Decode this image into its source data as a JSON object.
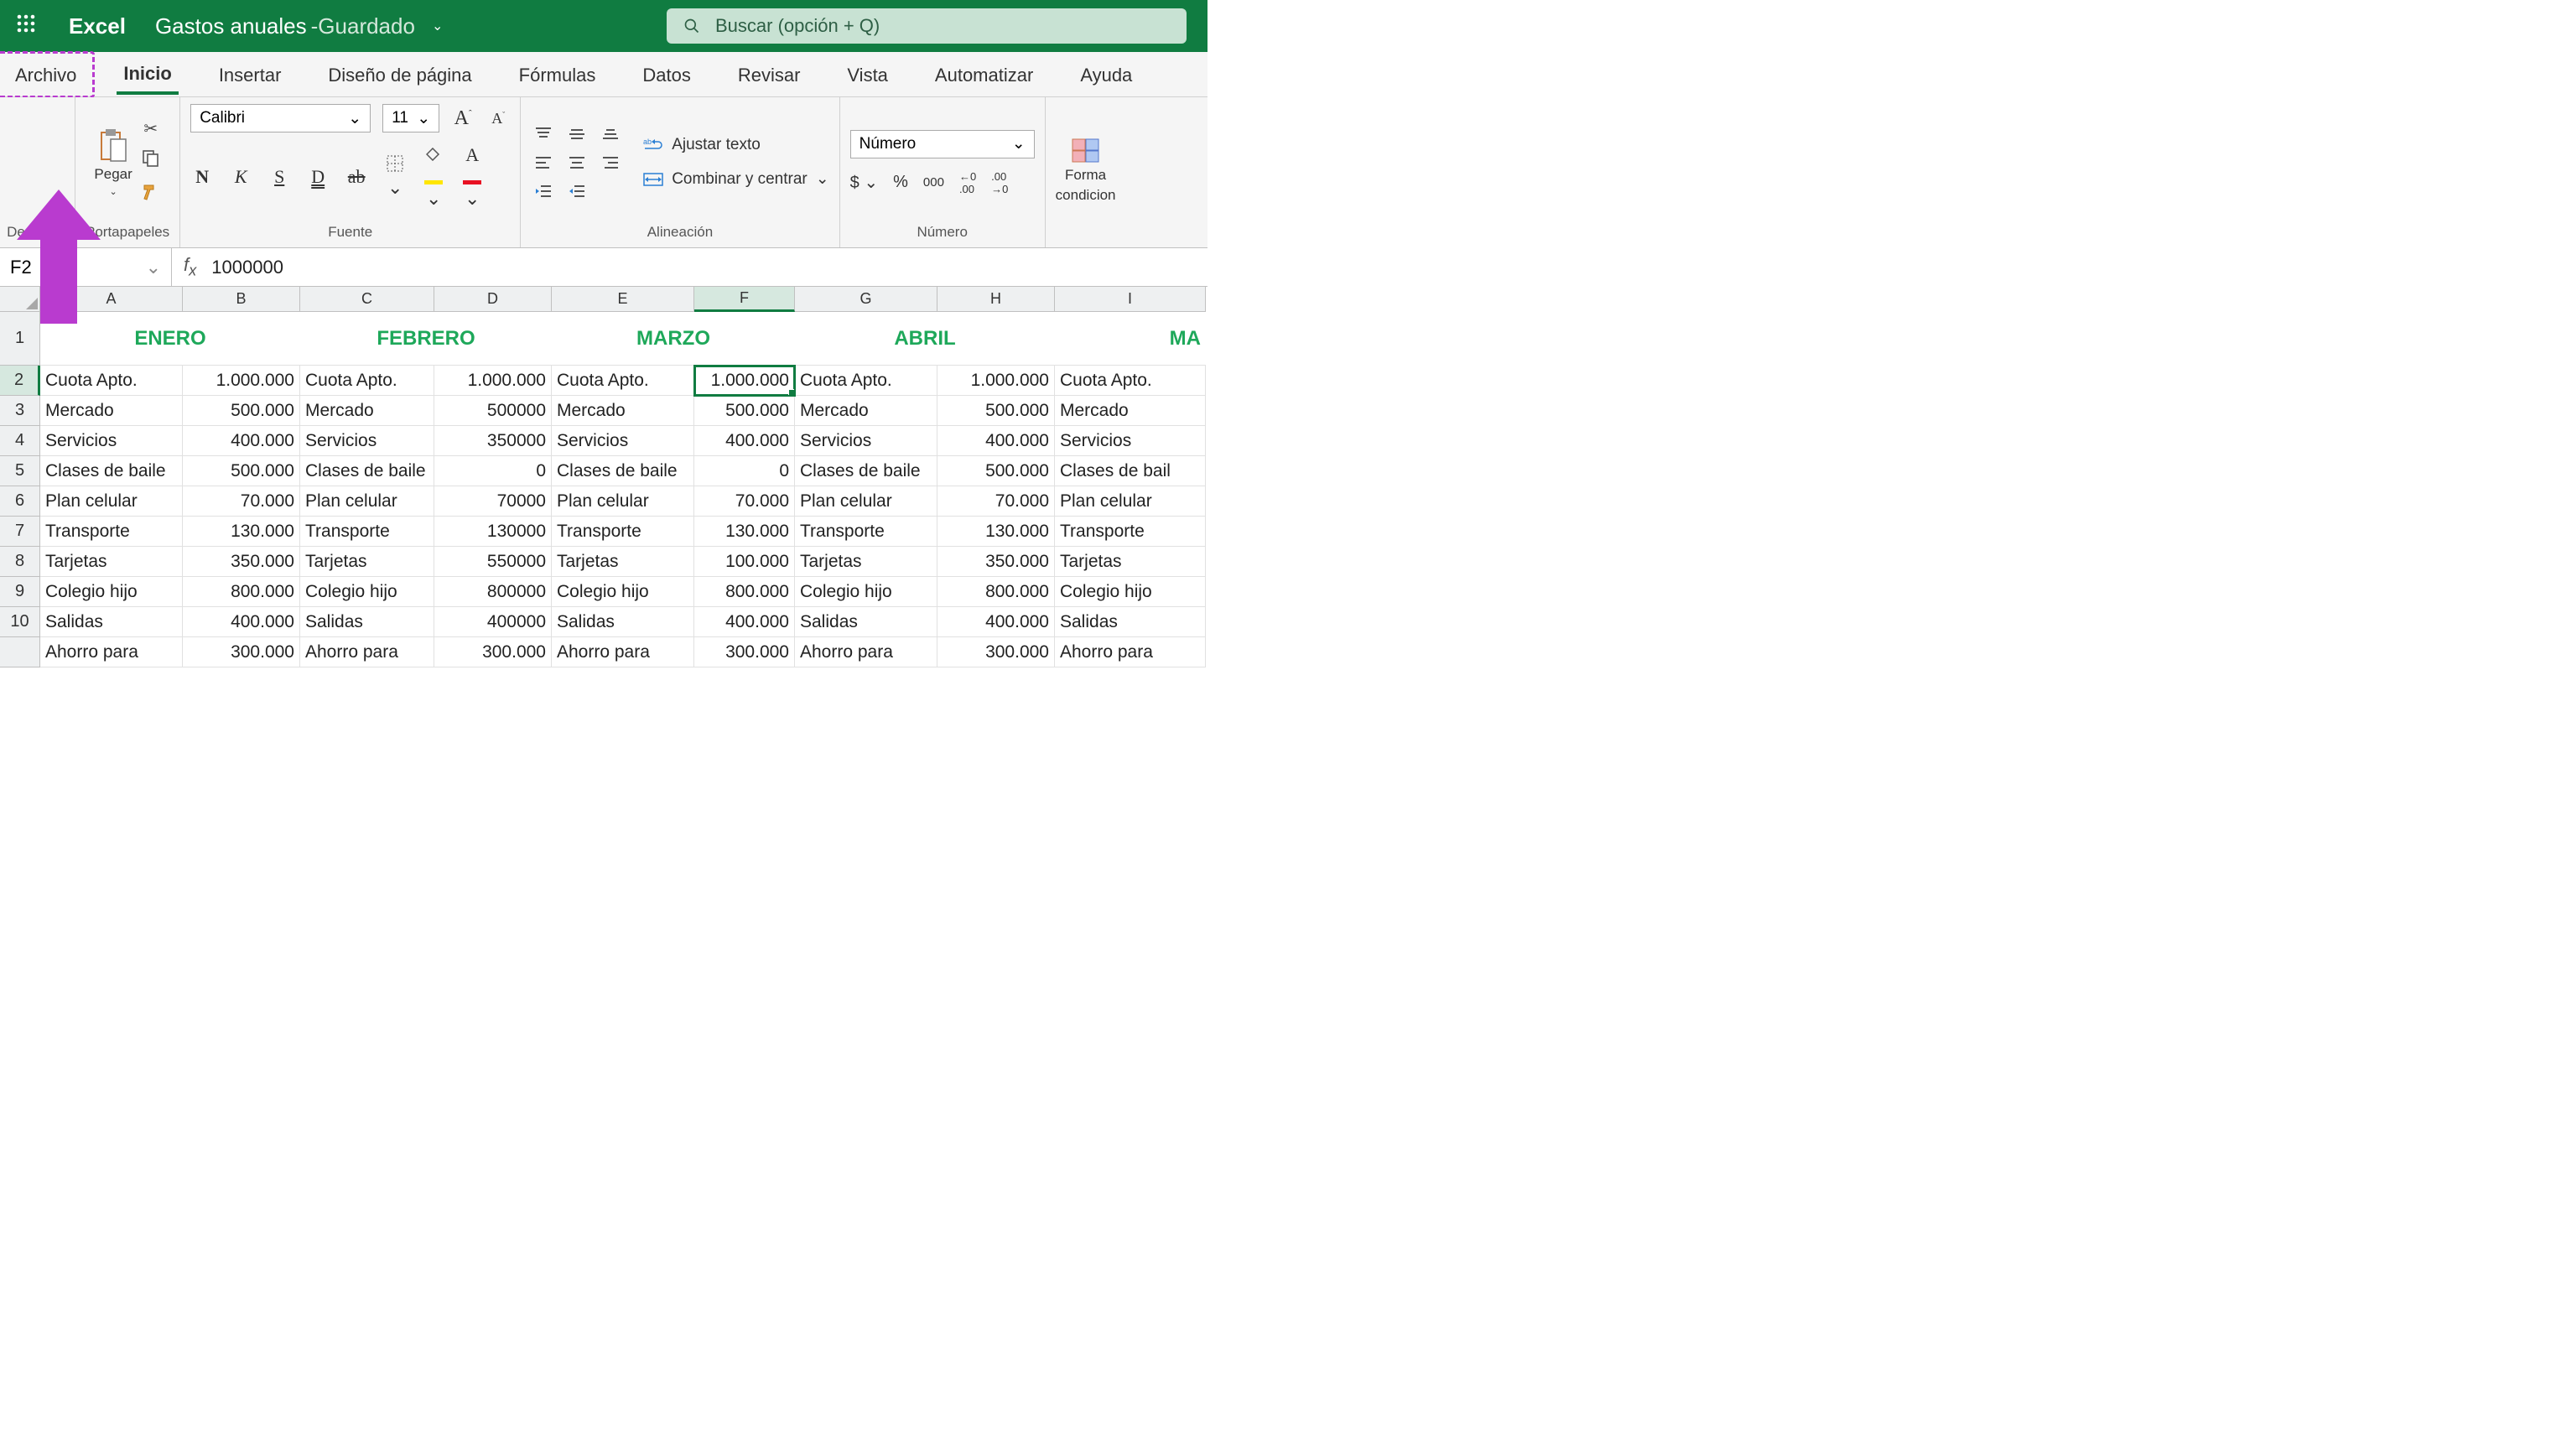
{
  "app": {
    "name": "Excel",
    "doc": "Gastos anuales",
    "status_sep": " - ",
    "status": "Guardado"
  },
  "search": {
    "placeholder": "Buscar (opción + Q)"
  },
  "tabs": [
    "Archivo",
    "Inicio",
    "Insertar",
    "Diseño de página",
    "Fórmulas",
    "Datos",
    "Revisar",
    "Vista",
    "Automatizar",
    "Ayuda"
  ],
  "ribbon": {
    "undo_label": "Deshacer",
    "clipboard_label": "Portapapeles",
    "paste_label": "Pegar",
    "font_label": "Fuente",
    "font_name": "Calibri",
    "font_size": "11",
    "align_label": "Alineación",
    "wrap_label": "Ajustar texto",
    "merge_label": "Combinar y centrar",
    "number_label": "Número",
    "number_format": "Número",
    "cond_fmt_l1": "Forma",
    "cond_fmt_l2": "condicion"
  },
  "namebox": "F2",
  "formula": "1000000",
  "cols": [
    {
      "l": "A",
      "w": 170
    },
    {
      "l": "B",
      "w": 140
    },
    {
      "l": "C",
      "w": 160
    },
    {
      "l": "D",
      "w": 140
    },
    {
      "l": "E",
      "w": 170
    },
    {
      "l": "F",
      "w": 120,
      "sel": true
    },
    {
      "l": "G",
      "w": 170
    },
    {
      "l": "H",
      "w": 140
    },
    {
      "l": "I",
      "w": 180
    }
  ],
  "row_heights": {
    "header": 64,
    "normal": 36
  },
  "row_labels": [
    "1",
    "2",
    "3",
    "4",
    "5",
    "6",
    "7",
    "8",
    "9",
    "10",
    ""
  ],
  "sel_row_idx": 1,
  "month_headers": {
    "B": "ENERO",
    "D": "FEBRERO",
    "F": "MARZO",
    "H": "ABRIL",
    "I_partial": "MA"
  },
  "rows": [
    [
      "Cuota Apto.",
      "1.000.000",
      "Cuota Apto.",
      "1.000.000",
      "Cuota Apto.",
      "1.000.000",
      "Cuota Apto.",
      "1.000.000",
      "Cuota Apto."
    ],
    [
      "Mercado",
      "500.000",
      "Mercado",
      "500000",
      "Mercado",
      "500.000",
      "Mercado",
      "500.000",
      "Mercado"
    ],
    [
      "Servicios",
      "400.000",
      "Servicios",
      "350000",
      "Servicios",
      "400.000",
      "Servicios",
      "400.000",
      "Servicios"
    ],
    [
      "Clases de baile",
      "500.000",
      "Clases de baile",
      "0",
      "Clases de baile",
      "0",
      "Clases de baile",
      "500.000",
      "Clases de bail"
    ],
    [
      "Plan celular",
      "70.000",
      "Plan celular",
      "70000",
      "Plan celular",
      "70.000",
      "Plan celular",
      "70.000",
      "Plan celular"
    ],
    [
      "Transporte",
      "130.000",
      "Transporte",
      "130000",
      "Transporte",
      "130.000",
      "Transporte",
      "130.000",
      "Transporte"
    ],
    [
      "Tarjetas",
      "350.000",
      "Tarjetas",
      "550000",
      "Tarjetas",
      "100.000",
      "Tarjetas",
      "350.000",
      "Tarjetas"
    ],
    [
      "Colegio hijo",
      "800.000",
      "Colegio hijo",
      "800000",
      "Colegio hijo",
      "800.000",
      "Colegio hijo",
      "800.000",
      "Colegio hijo"
    ],
    [
      "Salidas",
      "400.000",
      "Salidas",
      "400000",
      "Salidas",
      "400.000",
      "Salidas",
      "400.000",
      "Salidas"
    ],
    [
      "Ahorro para",
      "300.000",
      "Ahorro para",
      "300.000",
      "Ahorro para",
      "300.000",
      "Ahorro para",
      "300.000",
      "Ahorro para"
    ]
  ],
  "selected_cell": {
    "row": 0,
    "col": 5
  }
}
